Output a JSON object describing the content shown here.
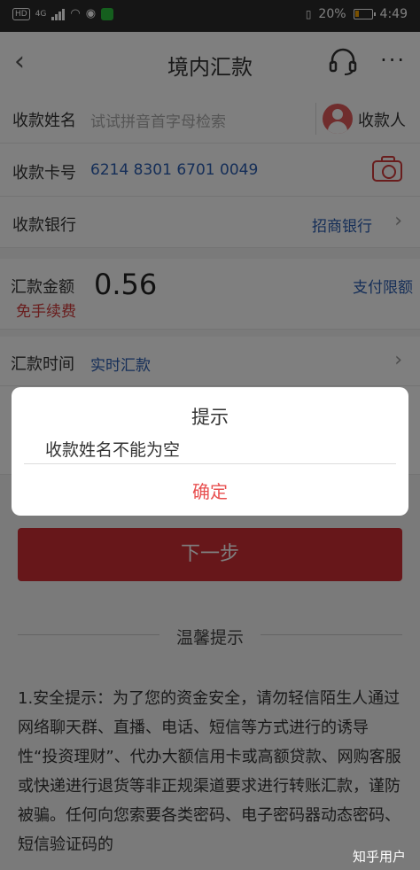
{
  "status_bar": {
    "network_badge": "HD",
    "network_type": "4G",
    "battery_percent": "20%",
    "time": "4:49"
  },
  "nav": {
    "title": "境内汇款",
    "more_label": "···"
  },
  "payee_name": {
    "label": "收款姓名",
    "placeholder": "试试拼音首字母检索",
    "payee_button_label": "收款人"
  },
  "card_number": {
    "label": "收款卡号",
    "value": "6214 8301 6701 0049"
  },
  "bank": {
    "label": "收款银行",
    "value": "招商银行"
  },
  "amount": {
    "label": "汇款金额",
    "fee_note": "免手续费",
    "value": "0.56",
    "limit_link": "支付限额"
  },
  "transfer_time": {
    "label": "汇款时间",
    "value": "实时汇款"
  },
  "next_button": "下一步",
  "tips": {
    "title": "温馨提示",
    "text": "1.安全提示：为了您的资金安全，请勿轻信陌生人通过网络聊天群、直播、电话、短信等方式进行的诱导性“投资理财”、代办大额信用卡或高额贷款、网购客服或快递进行退货等非正规渠道要求进行转账汇款，谨防被骗。任何向您索要各类密码、电子密码器动态密码、短信验证码的"
  },
  "dialog": {
    "title": "提示",
    "message": "收款姓名不能为空",
    "confirm": "确定"
  },
  "watermark": "知乎用户",
  "colors": {
    "accent_red": "#cf2e35",
    "link_blue": "#2a5db0",
    "dialog_button": "#e85050"
  }
}
